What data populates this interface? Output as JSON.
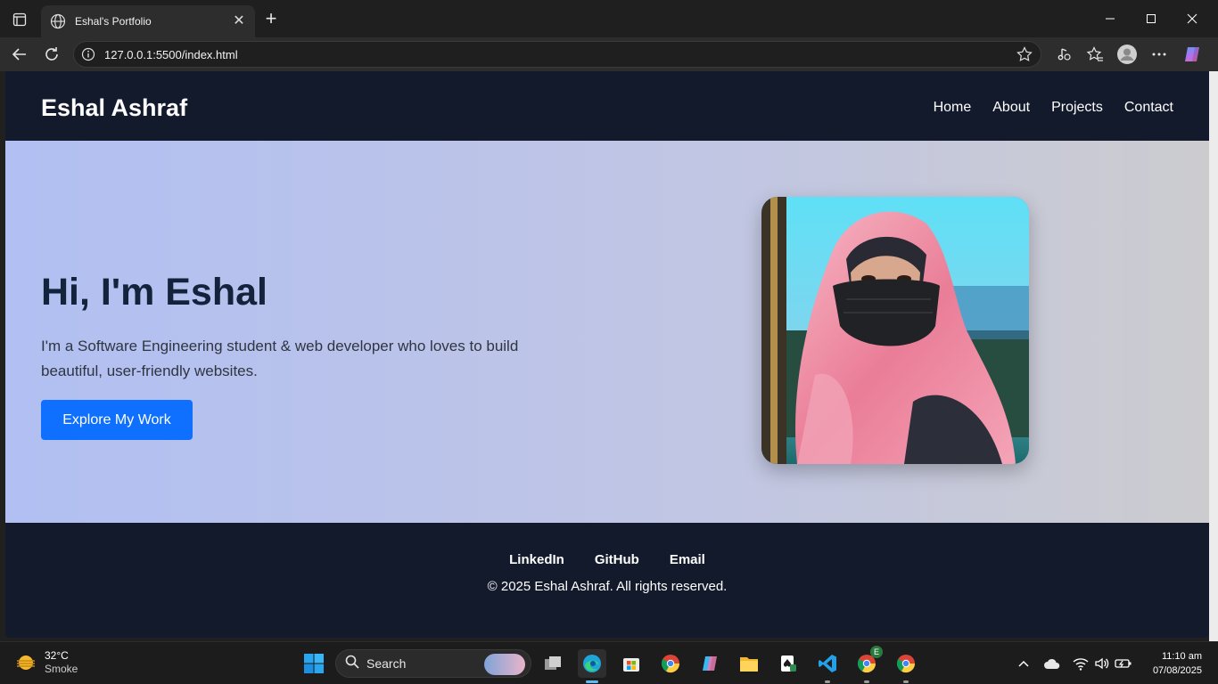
{
  "browser": {
    "tab_title": "Eshal's Portfolio",
    "url": "127.0.0.1:5500/index.html"
  },
  "site": {
    "logo": "Eshal Ashraf",
    "nav": [
      "Home",
      "About",
      "Projects",
      "Contact"
    ],
    "hero": {
      "title": "Hi, I'm Eshal",
      "description": "I'm a Software Engineering student & web developer who loves to build beautiful, user-friendly websites.",
      "button": "Explore My Work"
    },
    "footer": {
      "links": [
        "LinkedIn",
        "GitHub",
        "Email"
      ],
      "copyright": "© 2025 Eshal Ashraf. All rights reserved."
    }
  },
  "taskbar": {
    "weather": {
      "temp": "32°C",
      "condition": "Smoke"
    },
    "search_label": "Search",
    "clock": {
      "time": "11:10 am",
      "date": "07/08/2025"
    },
    "edge_badge": "E"
  },
  "colors": {
    "site_dark": "#121a2b",
    "hero_title": "#13233b",
    "button_blue": "#0f6fff"
  }
}
